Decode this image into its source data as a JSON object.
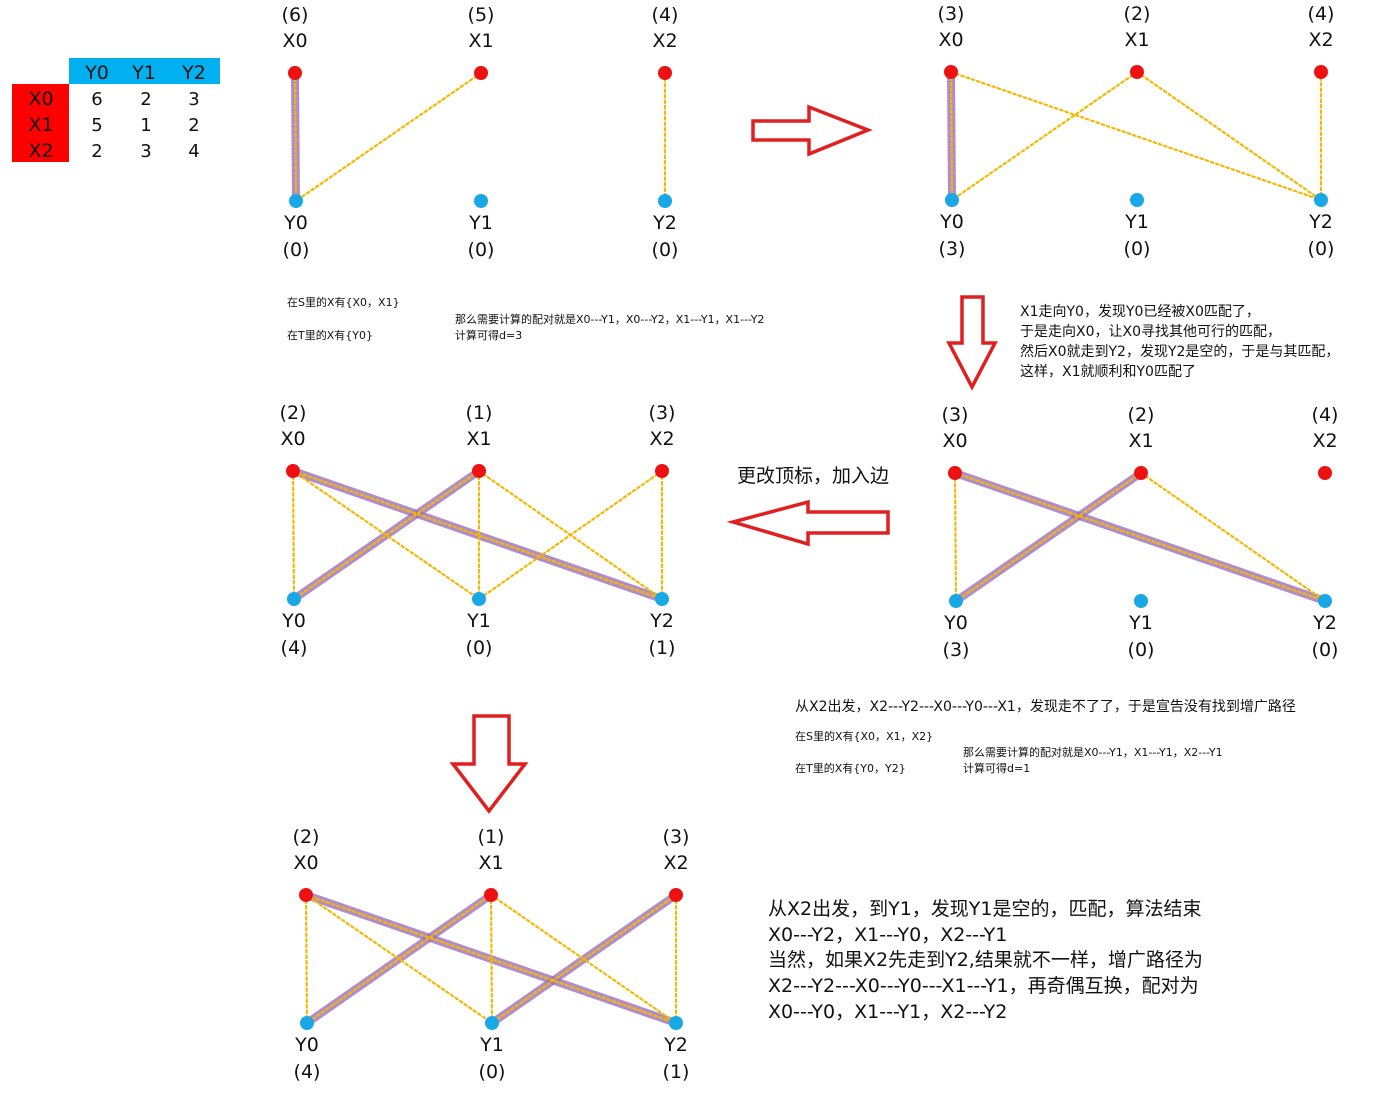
{
  "table": {
    "col_headers": [
      "Y0",
      "Y1",
      "Y2"
    ],
    "rows": [
      {
        "label": "X0",
        "values": [
          "6",
          "2",
          "3"
        ]
      },
      {
        "label": "X1",
        "values": [
          "5",
          "1",
          "2"
        ]
      },
      {
        "label": "X2",
        "values": [
          "2",
          "3",
          "4"
        ]
      }
    ],
    "header_color": "#00b0f0",
    "row_label_color": "#ff0000"
  },
  "panels": [
    {
      "x_labels": [
        "(6)",
        "(5)",
        "(4)"
      ],
      "y_labels": [
        "(0)",
        "(0)",
        "(0)"
      ],
      "matched": [
        [
          0,
          0
        ]
      ],
      "dotted": [
        [
          0,
          0
        ],
        [
          1,
          0
        ],
        [
          2,
          2
        ]
      ]
    },
    {
      "x_labels": [
        "(3)",
        "(2)",
        "(4)"
      ],
      "y_labels": [
        "(3)",
        "(0)",
        "(0)"
      ],
      "matched": [
        [
          0,
          0
        ]
      ],
      "dotted": [
        [
          0,
          0
        ],
        [
          0,
          2
        ],
        [
          1,
          0
        ],
        [
          1,
          2
        ],
        [
          2,
          2
        ]
      ]
    },
    {
      "x_labels": [
        "(3)",
        "(2)",
        "(4)"
      ],
      "y_labels": [
        "(3)",
        "(0)",
        "(0)"
      ],
      "matched": [
        [
          0,
          2
        ],
        [
          1,
          0
        ]
      ],
      "dotted": [
        [
          0,
          0
        ],
        [
          0,
          2
        ],
        [
          1,
          0
        ],
        [
          1,
          2
        ]
      ]
    },
    {
      "x_labels": [
        "(2)",
        "(1)",
        "(3)"
      ],
      "y_labels": [
        "(4)",
        "(0)",
        "(1)"
      ],
      "matched": [
        [
          0,
          2
        ],
        [
          1,
          0
        ]
      ],
      "dotted": [
        [
          0,
          0
        ],
        [
          0,
          1
        ],
        [
          0,
          2
        ],
        [
          1,
          0
        ],
        [
          1,
          1
        ],
        [
          1,
          2
        ],
        [
          2,
          1
        ],
        [
          2,
          2
        ]
      ]
    },
    {
      "x_labels": [
        "(2)",
        "(1)",
        "(3)"
      ],
      "y_labels": [
        "(4)",
        "(0)",
        "(1)"
      ],
      "matched": [
        [
          0,
          2
        ],
        [
          1,
          0
        ],
        [
          2,
          1
        ]
      ],
      "dotted": [
        [
          0,
          0
        ],
        [
          0,
          1
        ],
        [
          0,
          2
        ],
        [
          1,
          0
        ],
        [
          1,
          1
        ],
        [
          1,
          2
        ],
        [
          2,
          1
        ],
        [
          2,
          2
        ]
      ]
    }
  ],
  "node_names": {
    "x": [
      "X0",
      "X1",
      "X2"
    ],
    "y": [
      "Y0",
      "Y1",
      "Y2"
    ]
  },
  "colors": {
    "x_node": "#ee1111",
    "y_node": "#1aa7e6",
    "matched_edge": "#9a6fc0",
    "dotted_edge": "#f5b800",
    "arrow": "#e02020"
  },
  "notes": {
    "n1_s": "在S里的X有{X0，X1}",
    "n1_t": "在T里的X有{Y0}",
    "n1_pairs": "那么需要计算的配对就是X0---Y1，X0---Y2，X1---Y1，X1---Y2",
    "n1_d": "计算可得d=3",
    "n2_l1": "X1走向Y0，发现Y0已经被X0匹配了，",
    "n2_l2": "于是走向X0，让X0寻找其他可行的匹配，",
    "n2_l3": "然后X0就走到Y2，发现Y2是空的，于是与其匹配，",
    "n2_l4": "这样，X1就顺利和Y0匹配了",
    "n3_label": "更改顶标，加入边",
    "n4_l1": "从X2出发，X2---Y2---X0---Y0---X1，发现走不了了，于是宣告没有找到增广路径",
    "n4_s": "在S里的X有{X0，X1，X2}",
    "n4_t": "在T里的X有{Y0，Y2}",
    "n4_pairs": "那么需要计算的配对就是X0---Y1，X1---Y1，X2---Y1",
    "n4_d": "计算可得d=1",
    "n5_l1": "从X2出发，到Y1，发现Y1是空的，匹配，算法结束",
    "n5_l2": "X0---Y2，X1---Y0，X2---Y1",
    "n5_l3": "当然，如果X2先走到Y2,结果就不一样，增广路径为",
    "n5_l4": "X2---Y2---X0---Y0---X1---Y1，再奇偶互换，配对为",
    "n5_l5": "X0---Y0，X1---Y1，X2---Y2"
  }
}
